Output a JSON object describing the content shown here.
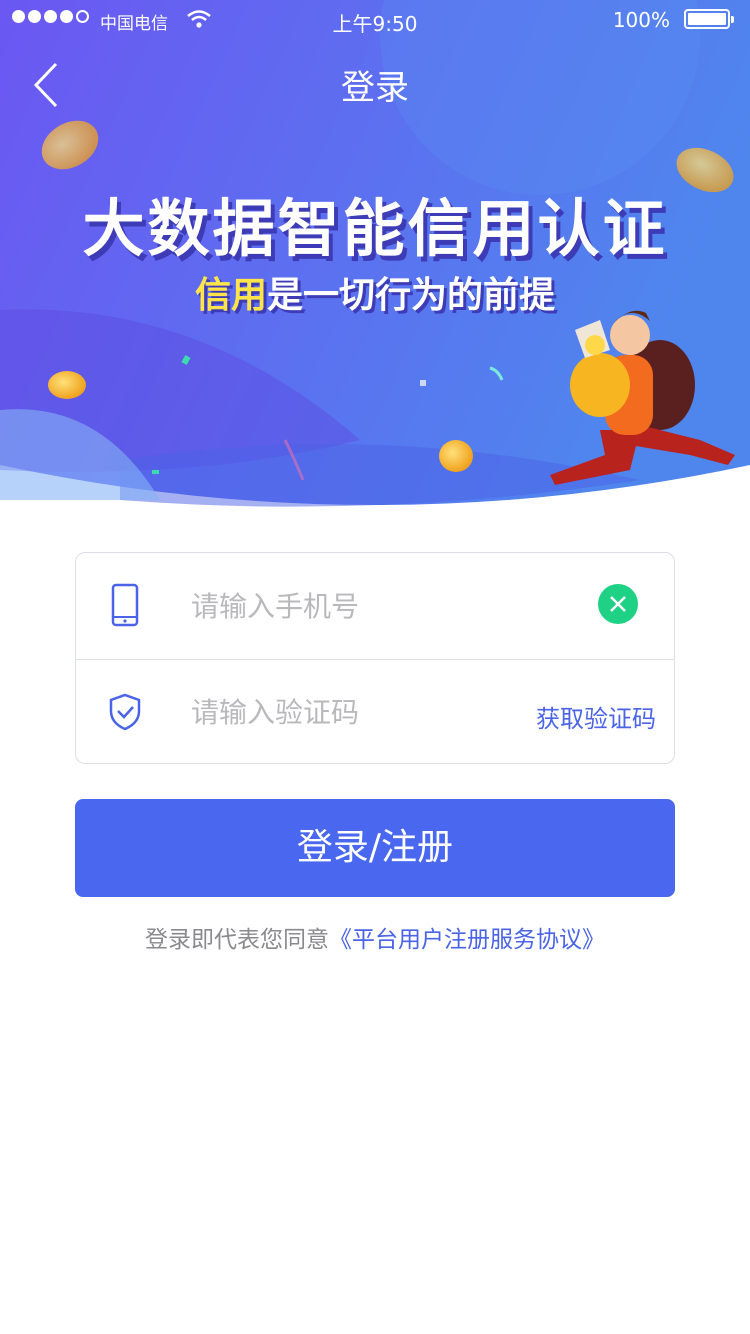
{
  "status_bar": {
    "carrier": "中国电信",
    "time": "上午9:50",
    "battery_percent": "100%"
  },
  "nav": {
    "title": "登录"
  },
  "hero": {
    "headline": "大数据智能信用认证",
    "subline_highlight": "信用",
    "subline_rest": "是一切行为的前提"
  },
  "form": {
    "phone_placeholder": "请输入手机号",
    "code_placeholder": "请输入验证码",
    "get_code": "获取验证码"
  },
  "login_button": "登录/注册",
  "agreement": {
    "prefix": "登录即代表您同意",
    "link": "《平台用户注册服务协议》"
  },
  "colors": {
    "primary": "#4a67ef",
    "clear_green": "#1ed184",
    "highlight_yellow": "#ffe54a",
    "link_blue": "#4a63e8"
  }
}
